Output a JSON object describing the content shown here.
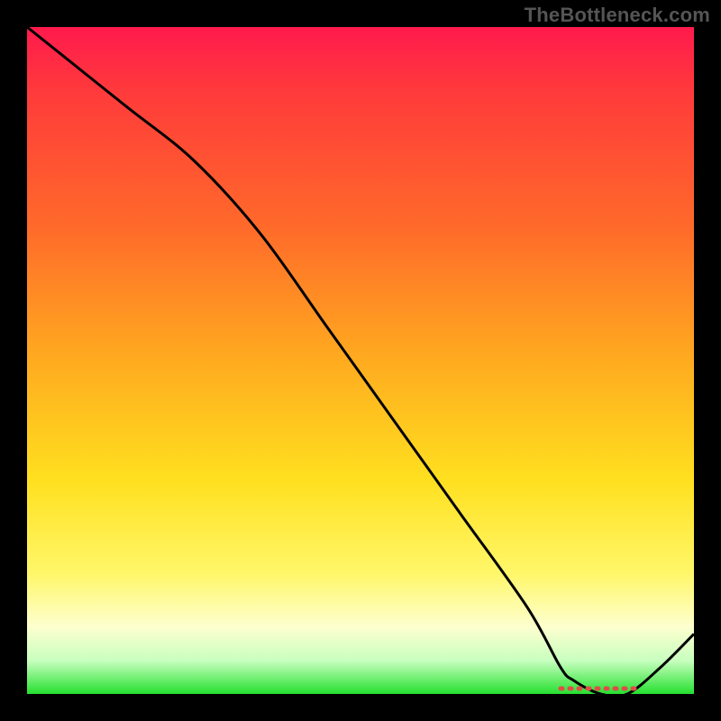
{
  "watermark": "TheBottleneck.com",
  "colors": {
    "gradient_top": "#ff1a4d",
    "gradient_mid": "#ffe01f",
    "gradient_bottom": "#25e02f",
    "curve": "#000000",
    "marker": "#e24a4a",
    "background": "#000000"
  },
  "chart_data": {
    "type": "line",
    "title": "",
    "xlabel": "",
    "ylabel": "",
    "xlim": [
      0,
      100
    ],
    "ylim": [
      0,
      100
    ],
    "x": [
      0,
      5,
      15,
      25,
      35,
      45,
      55,
      65,
      75,
      80,
      82,
      86,
      90,
      95,
      100
    ],
    "values": [
      100,
      96,
      88,
      80,
      69,
      55,
      41,
      27,
      13,
      4,
      2,
      0,
      0,
      4,
      9
    ],
    "annotations": [
      {
        "kind": "optimal_range_marker",
        "x_start": 80,
        "x_end": 92,
        "y": 0
      }
    ]
  }
}
